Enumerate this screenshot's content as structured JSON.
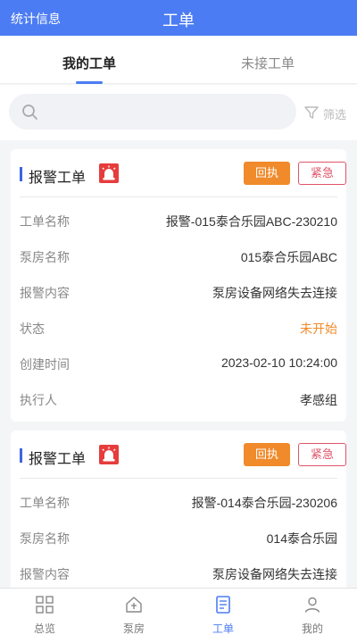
{
  "header": {
    "left_label": "统计信息",
    "title": "工单"
  },
  "tabs": [
    {
      "label": "我的工单",
      "active": true
    },
    {
      "label": "未接工单",
      "active": false
    }
  ],
  "search": {
    "placeholder": "",
    "filter_label": "筛选"
  },
  "cards": [
    {
      "title": "报警工单",
      "receipt_label": "回执",
      "urgent_label": "紧急",
      "rows": [
        {
          "key": "工单名称",
          "value": "报警-015泰合乐园ABC-230210"
        },
        {
          "key": "泵房名称",
          "value": "015泰合乐园ABC"
        },
        {
          "key": "报警内容",
          "value": "泵房设备网络失去连接"
        },
        {
          "key": "状态",
          "value": "未开始"
        },
        {
          "key": "创建时间",
          "value": "2023-02-10 10:24:00"
        },
        {
          "key": "执行人",
          "value": "孝感组"
        }
      ]
    },
    {
      "title": "报警工单",
      "receipt_label": "回执",
      "urgent_label": "紧急",
      "rows": [
        {
          "key": "工单名称",
          "value": "报警-014泰合乐园-230206"
        },
        {
          "key": "泵房名称",
          "value": "014泰合乐园"
        },
        {
          "key": "报警内容",
          "value": "泵房设备网络失去连接"
        }
      ]
    }
  ],
  "tabbar": [
    {
      "label": "总览",
      "icon": "grid-icon",
      "active": false
    },
    {
      "label": "泵房",
      "icon": "house-icon",
      "active": false
    },
    {
      "label": "工单",
      "icon": "document-icon",
      "active": true
    },
    {
      "label": "我的",
      "icon": "user-icon",
      "active": false
    }
  ],
  "colors": {
    "primary": "#4c7cf3",
    "orange": "#f08a2a",
    "urgent": "#e0556a"
  }
}
